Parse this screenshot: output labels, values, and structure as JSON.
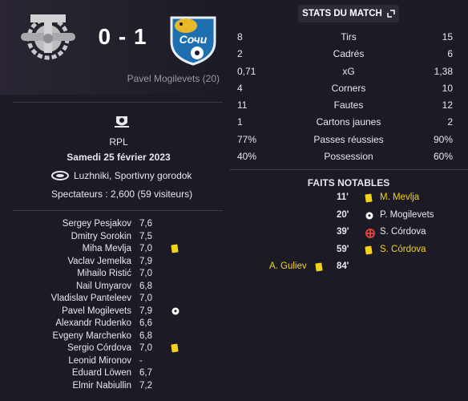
{
  "match": {
    "home_team": "Torpedo Moscou",
    "away_team": "Sochi",
    "score": "0 - 1",
    "away_scorer": "Pavel Mogilevets (20)",
    "competition": "RPL",
    "date": "Samedi 25 février 2023",
    "venue": "Luzhniki, Sportivny gorodok",
    "attendance": "Spectateurs : 2,600 (59 visiteurs)"
  },
  "ratings": [
    {
      "name": "Sergey Pesjakov",
      "rating": "7,6",
      "event": ""
    },
    {
      "name": "Dmitry Sorokin",
      "rating": "7,5",
      "event": ""
    },
    {
      "name": "Miha Mevlja",
      "rating": "7,0",
      "event": "yellow-card"
    },
    {
      "name": "Vaclav Jemelka",
      "rating": "7,9",
      "event": ""
    },
    {
      "name": "Mihailo Ristić",
      "rating": "7,0",
      "event": ""
    },
    {
      "name": "Nail Umyarov",
      "rating": "6,8",
      "event": ""
    },
    {
      "name": "Vladislav Panteleev",
      "rating": "7,0",
      "event": ""
    },
    {
      "name": "Pavel Mogilevets",
      "rating": "7,9",
      "event": "goal"
    },
    {
      "name": "Alexandr Rudenko",
      "rating": "6,6",
      "event": ""
    },
    {
      "name": "Evgeny Marchenko",
      "rating": "6,8",
      "event": ""
    },
    {
      "name": "Sergio Córdova",
      "rating": "7,0",
      "event": "yellow-card"
    },
    {
      "name": "Leonid Mironov",
      "rating": "-",
      "event": ""
    },
    {
      "name": "Eduard Löwen",
      "rating": "6,7",
      "event": ""
    },
    {
      "name": "Elmir Nabiullin",
      "rating": "7,2",
      "event": ""
    }
  ],
  "stats_panel": {
    "tab_label": "STATS DU MATCH",
    "rows": [
      {
        "label": "Tirs",
        "home": "8",
        "away": "15"
      },
      {
        "label": "Cadrés",
        "home": "2",
        "away": "6"
      },
      {
        "label": "xG",
        "home": "0,71",
        "away": "1,38"
      },
      {
        "label": "Corners",
        "home": "4",
        "away": "10"
      },
      {
        "label": "Fautes",
        "home": "11",
        "away": "12"
      },
      {
        "label": "Cartons jaunes",
        "home": "1",
        "away": "2"
      },
      {
        "label": "Passes réussies",
        "home": "77%",
        "away": "90%"
      },
      {
        "label": "Possession",
        "home": "40%",
        "away": "60%"
      }
    ]
  },
  "notable": {
    "title": "FAITS NOTABLES",
    "events": [
      {
        "minute": "11'",
        "side": "away",
        "type": "yellow-card",
        "player": "M. Mevlja",
        "highlight": true
      },
      {
        "minute": "20'",
        "side": "away",
        "type": "goal",
        "player": "P. Mogilevets",
        "highlight": false
      },
      {
        "minute": "39'",
        "side": "away",
        "type": "injury",
        "player": "S. Córdova",
        "highlight": false
      },
      {
        "minute": "59'",
        "side": "away",
        "type": "yellow-card",
        "player": "S. Córdova",
        "highlight": true
      },
      {
        "minute": "84'",
        "side": "home",
        "type": "yellow-card",
        "player": "A. Guliev",
        "highlight": true
      }
    ]
  },
  "colors": {
    "background": "#1c1a24",
    "yellow_card": "#f2d21a",
    "injury": "#e0403a"
  }
}
